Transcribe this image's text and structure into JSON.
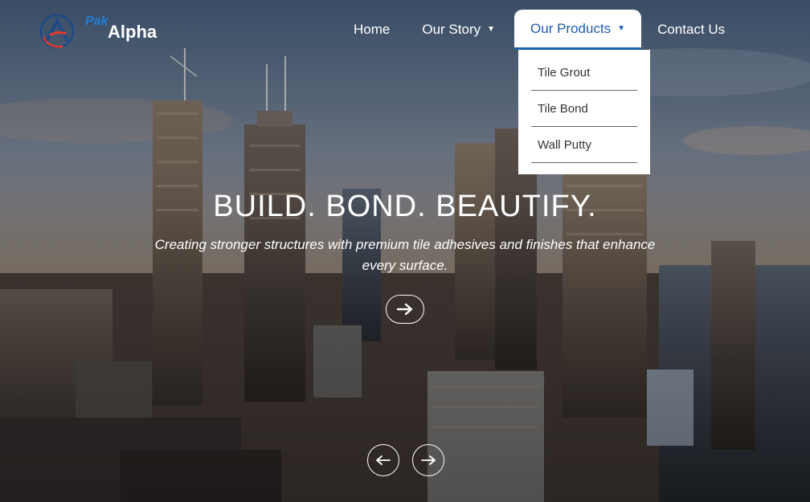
{
  "brand": {
    "pak": "Pak",
    "alpha": "Alpha",
    "colors": {
      "pak": "#1e7ed6",
      "alpha": "#ffffff",
      "mark_blue": "#1e4a8a",
      "mark_red": "#e03a2a"
    }
  },
  "nav": {
    "items": [
      {
        "label": "Home",
        "has_caret": false
      },
      {
        "label": "Our Story",
        "has_caret": true
      },
      {
        "label": "Our Products",
        "has_caret": true,
        "active": true
      },
      {
        "label": "Contact Us",
        "has_caret": false
      }
    ],
    "caret_glyph": "▼",
    "active_color": "#1f5fa8"
  },
  "dropdown": {
    "items": [
      "Tile Grout",
      "Tile Bond",
      "Wall Putty"
    ]
  },
  "hero": {
    "headline": "BUILD. BOND. BEAUTIFY.",
    "subline": "Creating stronger structures with premium tile adhesives and finishes that enhance every surface.",
    "cta_icon": "arrow-right-icon",
    "prev_icon": "arrow-left-icon",
    "next_icon": "arrow-right-icon"
  }
}
